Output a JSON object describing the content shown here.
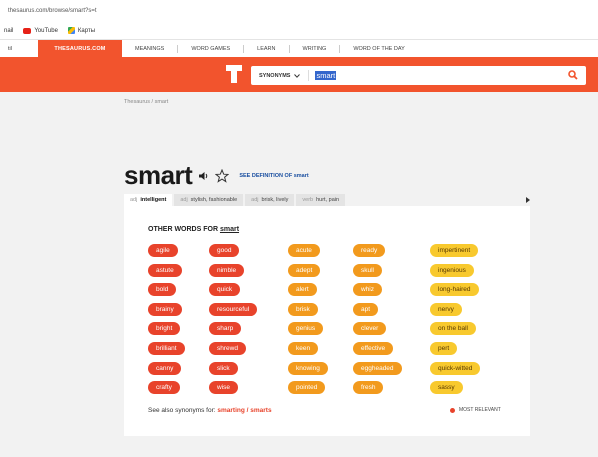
{
  "browser": {
    "url": "thesaurus.com/browse/smart?s=t",
    "bookmarks": [
      {
        "label": "nail"
      },
      {
        "label": "YouTube"
      },
      {
        "label": "Карты"
      }
    ]
  },
  "nav": {
    "fragment": "til",
    "brand": "THESAURUS.COM",
    "items": [
      "MEANINGS",
      "WORD GAMES",
      "LEARN",
      "WRITING",
      "WORD OF THE DAY"
    ]
  },
  "search": {
    "mode": "SYNONYMS",
    "query": "smart"
  },
  "breadcrumb": "Thesaurus / smart",
  "headword": {
    "word": "smart",
    "see_definition": "SEE DEFINITION OF smart"
  },
  "tabs": [
    {
      "pos": "adj",
      "label": "intelligent"
    },
    {
      "pos": "adj",
      "label": "stylish, fashionable"
    },
    {
      "pos": "adj",
      "label": "brisk, lively"
    },
    {
      "pos": "verb",
      "label": "hurt, pain"
    }
  ],
  "other_words": {
    "heading_prefix": "OTHER WORDS FOR",
    "heading_word": "smart",
    "columns": [
      {
        "color": "red",
        "words": [
          "agile",
          "astute",
          "bold",
          "brainy",
          "bright",
          "brilliant",
          "canny",
          "crafty"
        ]
      },
      {
        "color": "red",
        "words": [
          "good",
          "nimble",
          "quick",
          "resourceful",
          "sharp",
          "shrewd",
          "slick",
          "wise"
        ]
      },
      {
        "color": "orange",
        "words": [
          "acute",
          "adept",
          "alert",
          "brisk",
          "genius",
          "keen",
          "knowing",
          "pointed"
        ]
      },
      {
        "color": "orange",
        "words": [
          "ready",
          "skull",
          "whiz",
          "apt",
          "clever",
          "effective",
          "eggheaded",
          "fresh"
        ]
      },
      {
        "color": "yellow",
        "words": [
          "impertinent",
          "ingenious",
          "long-haired",
          "nervy",
          "on the ball",
          "pert",
          "quick-witted",
          "sassy"
        ]
      }
    ]
  },
  "see_also": {
    "prefix": "See also synonyms for:",
    "link1": "smarting",
    "sep": "/",
    "link2": "smarts"
  },
  "legend": "MOST RELEVANT",
  "colors": {
    "brand": "#f2542d",
    "red": "#e8432b",
    "orange": "#f29a1d",
    "yellow": "#f8c92e"
  }
}
